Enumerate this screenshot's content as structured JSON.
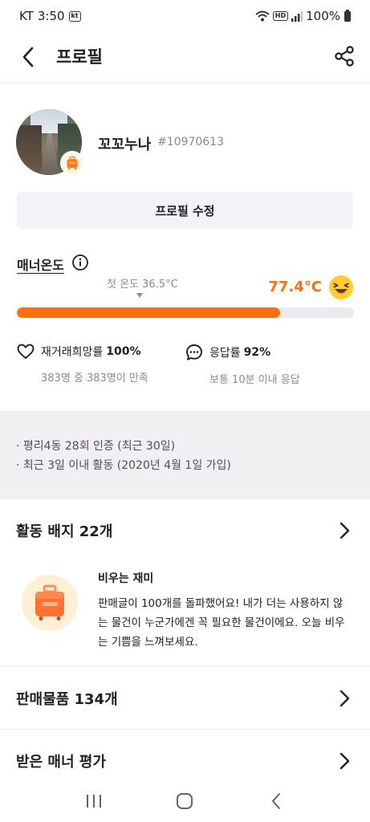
{
  "status_bar": {
    "carrier": "KT",
    "time": "3:50",
    "carrier_badge": "kt",
    "hd_label": "HD",
    "battery": "100%",
    "icons": [
      "wifi-icon",
      "hd-icon",
      "signal-icon",
      "battery-icon"
    ]
  },
  "app_bar": {
    "title": "프로필",
    "back_icon": "chevron-left-icon",
    "share_icon": "share-icon"
  },
  "profile": {
    "nickname": "꼬꼬누나",
    "user_id": "#10970613",
    "avatar_badge_icon": "luggage-icon",
    "edit_button_label": "프로필 수정"
  },
  "manner": {
    "label": "매너온도",
    "first_temp_label": "첫 온도 36.5°C",
    "temp_value": "77.4°C",
    "temp_fill_fraction": 0.78,
    "emoji_icon": "laughing-face-icon",
    "accent_color": "#ff6f0f"
  },
  "stats": {
    "rehire": {
      "label": "재거래희망률",
      "value": "100%",
      "sub": "383명 중 383명이 만족",
      "icon": "heart-icon"
    },
    "response": {
      "label": "응답률",
      "value": "92%",
      "sub": "보통 10분 이내 응답",
      "icon": "chat-bubble-icon"
    }
  },
  "info": {
    "line1": "· 평리4동 28회 인증 (최근 30일)",
    "line2": "· 최근 3일 이내 활동 (2020년 4월 1일 가입)"
  },
  "badges": {
    "title": "활동 배지 22개",
    "name": "비우는 재미",
    "description": "판매글이 100개를 돌파했어요! 내가 더는 사용하지 않는 물건이 누군가에겐 꼭 필요한 물건이에요. 오늘 비우는 기쁨을 느껴보세요.",
    "icon": "suitcase-icon"
  },
  "sales": {
    "title": "판매물품 134개"
  },
  "reviews": {
    "title": "받은 매너 평가"
  },
  "nav": {
    "icons": [
      "recent-apps-icon",
      "home-icon",
      "back-icon"
    ]
  }
}
